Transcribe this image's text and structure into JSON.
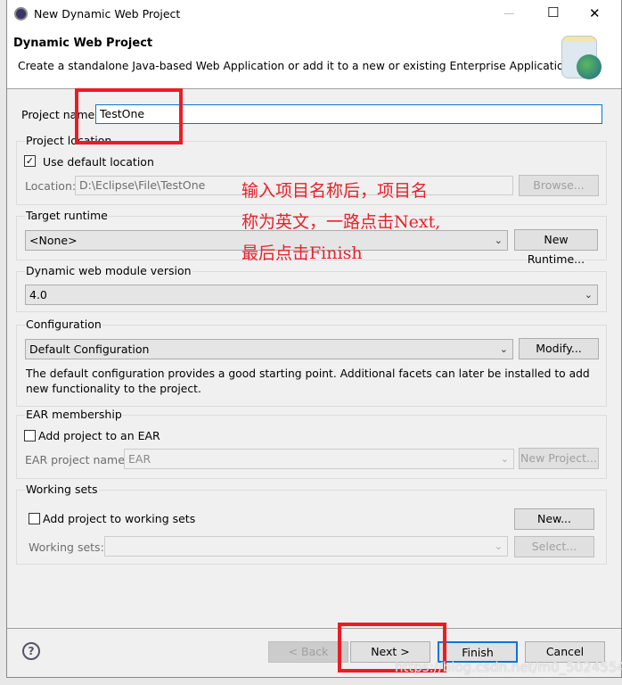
{
  "window": {
    "title": "New Dynamic Web Project",
    "minimize": "—",
    "maximize": "☐",
    "close": "✕"
  },
  "header": {
    "title": "Dynamic Web Project",
    "description": "Create a standalone Java-based Web Application or add it to a new or existing Enterprise Application."
  },
  "project_name": {
    "label": "Project name:",
    "value": "TestOne"
  },
  "project_location": {
    "group": "Project location",
    "use_default": "Use default location",
    "use_default_checked": true,
    "location_label": "Location:",
    "location_value": "D:\\Eclipse\\File\\TestOne",
    "browse": "Browse..."
  },
  "target_runtime": {
    "group": "Target runtime",
    "value": "<None>",
    "new_runtime": "New Runtime..."
  },
  "module_version": {
    "group": "Dynamic web module version",
    "value": "4.0"
  },
  "configuration": {
    "group": "Configuration",
    "value": "Default Configuration",
    "modify": "Modify...",
    "description": "The default configuration provides a good starting point. Additional facets can later be installed to add new functionality to the project."
  },
  "ear": {
    "group": "EAR membership",
    "add_label": "Add project to an EAR",
    "add_checked": false,
    "name_label": "EAR project name:",
    "name_value": "EAR",
    "new_project": "New Project..."
  },
  "working_sets": {
    "group": "Working sets",
    "add_label": "Add project to working sets",
    "add_checked": false,
    "new": "New...",
    "sets_label": "Working sets:",
    "select": "Select..."
  },
  "footer": {
    "back": "< Back",
    "next": "Next >",
    "finish": "Finish",
    "cancel": "Cancel"
  },
  "annotation": {
    "lines": [
      "输入项目名称后，项目名",
      "称为英文，一路点击Next,",
      "最后点击Finish"
    ],
    "color": "#ec1c24"
  },
  "watermark": "https://blog.csdn.net/m0_50245541"
}
